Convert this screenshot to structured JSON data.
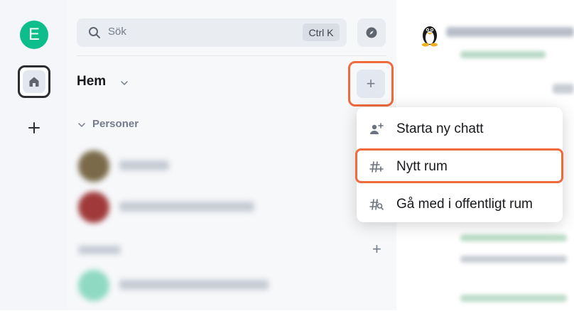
{
  "spaces": {
    "avatar_letter": "E",
    "add_icon": "plus-icon",
    "home_icon": "home-icon"
  },
  "search": {
    "placeholder": "Sök",
    "shortcut": "Ctrl K",
    "explore_icon": "compass-icon"
  },
  "room_list": {
    "title": "Hem",
    "people_header": "Personer",
    "add_button": "+",
    "add_room_button": "+"
  },
  "context_menu": {
    "items": [
      {
        "label": "Starta ny chatt",
        "icon": "new-chat-icon"
      },
      {
        "label": "Nytt rum",
        "icon": "hash-plus-icon"
      },
      {
        "label": "Gå med i offentligt rum",
        "icon": "hash-search-icon"
      }
    ]
  },
  "colors": {
    "accent": "#0dbd8b",
    "highlight": "#ef6a3d",
    "panel_bg": "#f7f8fa"
  }
}
